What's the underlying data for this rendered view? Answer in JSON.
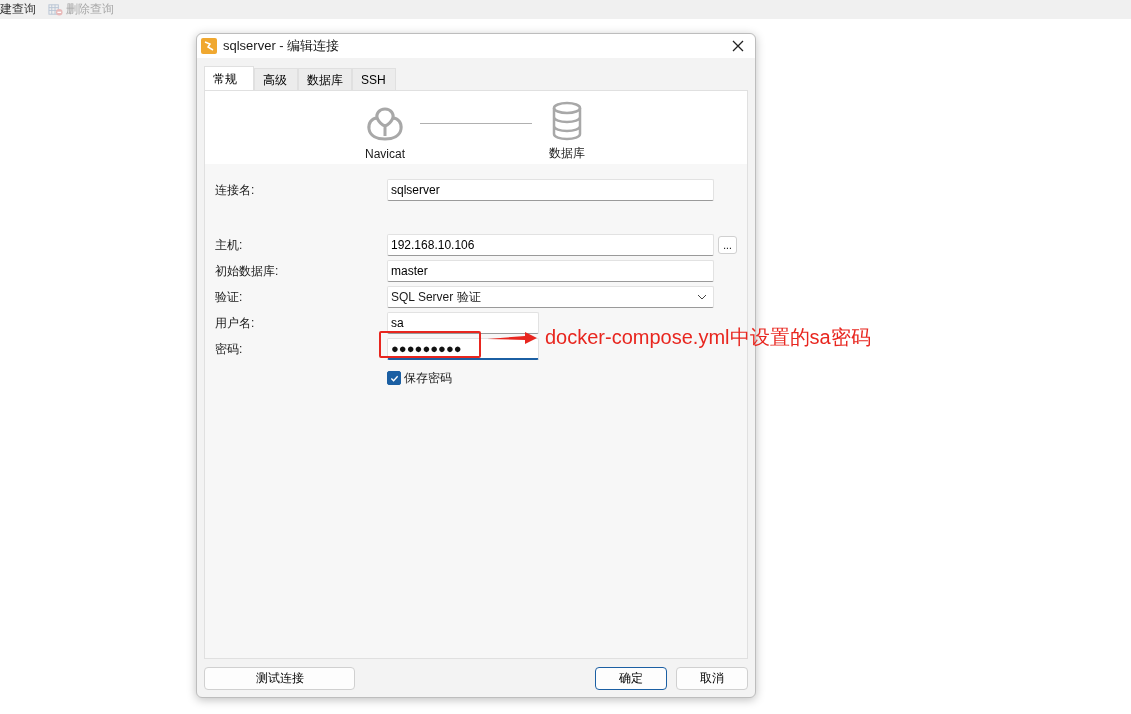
{
  "toolbar": [
    {
      "label": "建查询",
      "disabled": false
    },
    {
      "label": "删除查询",
      "disabled": true
    }
  ],
  "dialog": {
    "title": "sqlserver - 编辑连接",
    "tabs": [
      {
        "label": "常规",
        "selected": true
      },
      {
        "label": "高级",
        "selected": false
      },
      {
        "label": "数据库",
        "selected": false
      },
      {
        "label": "SSH",
        "selected": false
      }
    ],
    "diagram": {
      "left_label": "Navicat",
      "right_label": "数据库"
    },
    "name_field": {
      "label": "连接名:",
      "value": "sqlserver"
    },
    "fields": [
      {
        "kind": "browse",
        "label": "主机:",
        "value": "192.168.10.106",
        "button": "..."
      },
      {
        "kind": "text",
        "label": "初始数据库:",
        "value": "master"
      },
      {
        "kind": "select",
        "label": "验证:",
        "value": "SQL Server 验证"
      },
      {
        "kind": "short",
        "label": "用户名:",
        "value": "sa"
      },
      {
        "kind": "password",
        "label": "密码:",
        "value": "●●●●●●●●●"
      }
    ],
    "save_password": {
      "label": "保存密码",
      "checked": true
    },
    "buttons": [
      {
        "label": "测试连接",
        "kind": "left"
      },
      {
        "label": "确定",
        "kind": "default"
      },
      {
        "label": "取消",
        "kind": "normal"
      }
    ]
  },
  "annotation": {
    "text": "docker-compose.yml中设置的sa密码"
  }
}
